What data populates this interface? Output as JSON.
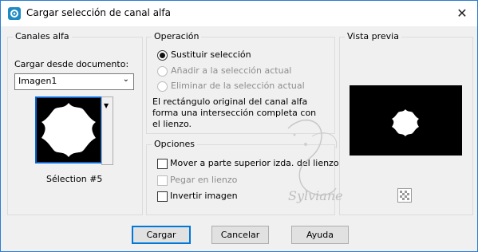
{
  "window": {
    "title": "Cargar selección de canal alfa",
    "close_glyph": "✕"
  },
  "alpha_channels": {
    "legend": "Canales alfa",
    "load_from_label": "Cargar desde documento:",
    "document_select_value": "Imagen1",
    "selection_caption": "Sélection #5"
  },
  "operation": {
    "legend": "Operación",
    "options": [
      {
        "label": "Sustituir selección",
        "checked": true,
        "enabled": true
      },
      {
        "label": "Añadir a la selección actual",
        "checked": false,
        "enabled": false
      },
      {
        "label": "Eliminar de la selección actual",
        "checked": false,
        "enabled": false
      }
    ],
    "info_line1": "El rectángulo original del canal alfa",
    "info_line2": "forma una intersección completa con",
    "info_line3": "el lienzo."
  },
  "options": {
    "legend": "Opciones",
    "checkboxes": [
      {
        "label": "Mover a parte superior izda. del lienzo",
        "checked": false,
        "enabled": true
      },
      {
        "label": "Pegar en lienzo",
        "checked": false,
        "enabled": false
      },
      {
        "label": "Invertir imagen",
        "checked": false,
        "enabled": true
      }
    ]
  },
  "preview": {
    "legend": "Vista previa",
    "zoom_icon": "checker-zoom-icon"
  },
  "buttons": {
    "load": "Cargar",
    "cancel": "Cancelar",
    "help": "Ayuda"
  },
  "watermark": {
    "text": "Sylviane"
  },
  "colors": {
    "title_border": "#2b7fd1",
    "selection_frame": "#0a64d4",
    "default_button_border": "#0078d7"
  }
}
